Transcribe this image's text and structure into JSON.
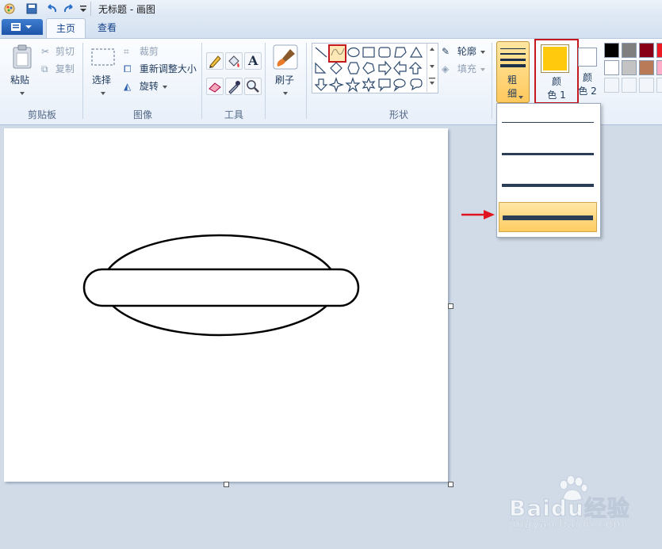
{
  "title_bar": {
    "title": "无标题 - 画图"
  },
  "tabs": {
    "file_label": "",
    "home": "主页",
    "view": "查看"
  },
  "clipboard": {
    "paste": "粘贴",
    "cut": "剪切",
    "copy": "复制",
    "group": "剪贴板"
  },
  "image": {
    "select": "选择",
    "crop": "裁剪",
    "resize": "重新调整大小",
    "rotate": "旋转",
    "group": "图像"
  },
  "tools": {
    "group": "工具",
    "text_glyph": "A"
  },
  "brushes": {
    "label": "刷子"
  },
  "shapes": {
    "outline": "轮廓",
    "fill": "填充",
    "group": "形状"
  },
  "size": {
    "label": "粗细"
  },
  "color1": {
    "label": "颜色 1",
    "value": "#ffc90e"
  },
  "color2": {
    "label": "颜色 2",
    "value": "#ffffff"
  },
  "palette": [
    "#000000",
    "#7f7f7f",
    "#880015",
    "#ed1c24",
    "#ffffff",
    "#c3c3c3",
    "#b97a57",
    "#ffaec9"
  ],
  "size_menu": {
    "options": [
      "1px",
      "3px",
      "5px",
      "8px"
    ],
    "selected_index": 3
  },
  "watermark": {
    "brand": "Baidu经验",
    "url": "jingyan.baidu.com"
  }
}
